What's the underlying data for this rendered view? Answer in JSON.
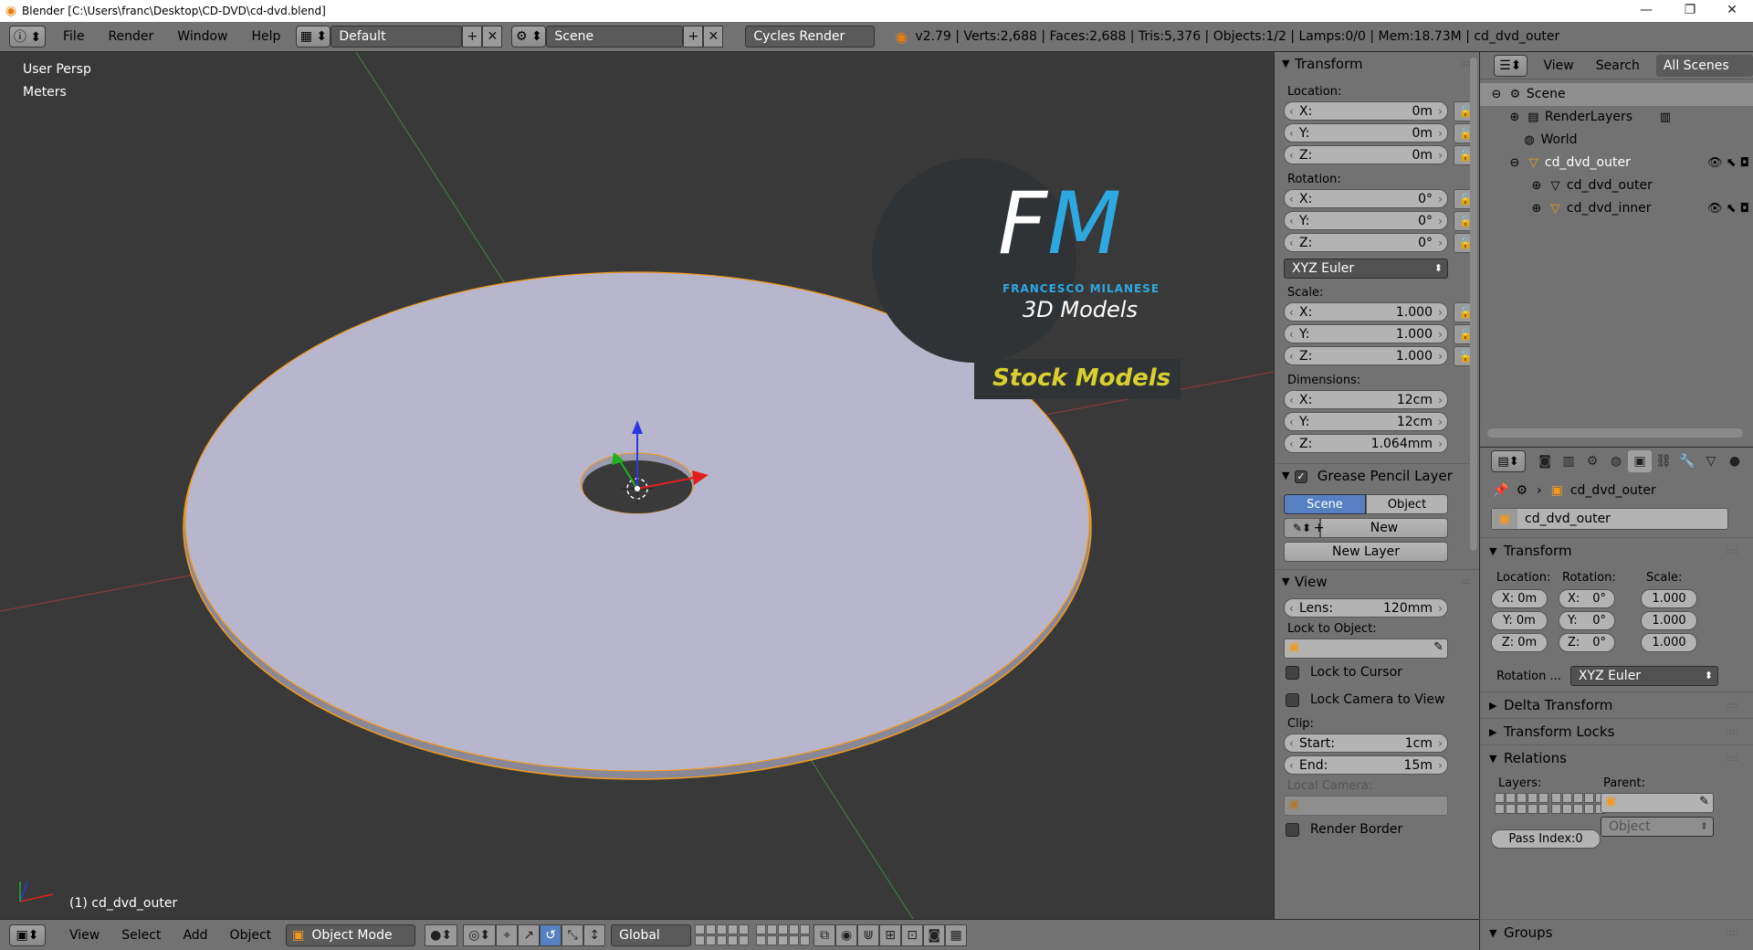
{
  "window": {
    "title": "Blender [C:\\Users\\franc\\Desktop\\CD-DVD\\cd-dvd.blend]",
    "minimize": "—",
    "maximize": "❐",
    "close": "✕"
  },
  "info_header": {
    "menus": [
      "File",
      "Render",
      "Window",
      "Help"
    ],
    "screen_layout": "Default",
    "scene": "Scene",
    "render_engine": "Cycles Render",
    "stats": "v2.79 | Verts:2,688 | Faces:2,688 | Tris:5,376 | Objects:1/2 | Lamps:0/0 | Mem:18.73M | cd_dvd_outer"
  },
  "viewport": {
    "view_name": "User Persp",
    "units": "Meters",
    "active_object": "(1) cd_dvd_outer",
    "watermark": {
      "initials": "FM",
      "name": "FRANCESCO MILANESE",
      "tagline": "3D Models",
      "banner": "Stock Models"
    }
  },
  "npanel": {
    "transform": {
      "title": "Transform",
      "location_label": "Location:",
      "location": [
        {
          "axis": "X:",
          "value": "0m"
        },
        {
          "axis": "Y:",
          "value": "0m"
        },
        {
          "axis": "Z:",
          "value": "0m"
        }
      ],
      "rotation_label": "Rotation:",
      "rotation": [
        {
          "axis": "X:",
          "value": "0°"
        },
        {
          "axis": "Y:",
          "value": "0°"
        },
        {
          "axis": "Z:",
          "value": "0°"
        }
      ],
      "rotation_mode": "XYZ Euler",
      "scale_label": "Scale:",
      "scale": [
        {
          "axis": "X:",
          "value": "1.000"
        },
        {
          "axis": "Y:",
          "value": "1.000"
        },
        {
          "axis": "Z:",
          "value": "1.000"
        }
      ],
      "dimensions_label": "Dimensions:",
      "dimensions": [
        {
          "axis": "X:",
          "value": "12cm"
        },
        {
          "axis": "Y:",
          "value": "12cm"
        },
        {
          "axis": "Z:",
          "value": "1.064mm"
        }
      ]
    },
    "grease_pencil": {
      "title": "Grease Pencil Layer",
      "tab_scene": "Scene",
      "tab_object": "Object",
      "new_label": "New",
      "new_layer_label": "New Layer"
    },
    "view": {
      "title": "View",
      "lens_label": "Lens:",
      "lens_value": "120mm",
      "lock_to_object_label": "Lock to Object:",
      "lock_to_cursor": "Lock to Cursor",
      "lock_camera": "Lock Camera to View",
      "clip_label": "Clip:",
      "clip_start_label": "Start:",
      "clip_start": "1cm",
      "clip_end_label": "End:",
      "clip_end": "15m",
      "local_camera_label": "Local Camera:",
      "render_border": "Render Border"
    }
  },
  "outliner": {
    "header": {
      "view": "View",
      "search": "Search",
      "filter": "All Scenes"
    },
    "items": [
      {
        "label": "Scene"
      },
      {
        "label": "RenderLayers"
      },
      {
        "label": "World"
      },
      {
        "label": "cd_dvd_outer"
      },
      {
        "label": "cd_dvd_outer"
      },
      {
        "label": "cd_dvd_inner"
      }
    ]
  },
  "properties": {
    "breadcrumb_object": "cd_dvd_outer",
    "object_name": "cd_dvd_outer",
    "transform": {
      "title": "Transform",
      "location_label": "Location:",
      "rotation_label": "Rotation:",
      "scale_label": "Scale:",
      "location": [
        "X: 0m",
        "Y: 0m",
        "Z: 0m"
      ],
      "rotation": [
        {
          "axis": "X:",
          "value": "0°"
        },
        {
          "axis": "Y:",
          "value": "0°"
        },
        {
          "axis": "Z:",
          "value": "0°"
        }
      ],
      "scale": [
        "1.000",
        "1.000",
        "1.000"
      ],
      "rotation_mode_label": "Rotation ...",
      "rotation_mode": "XYZ Euler"
    },
    "delta_transform": "Delta Transform",
    "transform_locks": "Transform Locks",
    "relations": {
      "title": "Relations",
      "layers_label": "Layers:",
      "parent_label": "Parent:",
      "parent_type": "Object",
      "pass_index": "Pass Index:0"
    },
    "groups": "Groups"
  },
  "bottom_header": {
    "menus": [
      "View",
      "Select",
      "Add",
      "Object"
    ],
    "mode": "Object Mode",
    "orientation": "Global"
  },
  "colors": {
    "panel_bg": "#727272",
    "viewport_bg": "#393939",
    "disc_face": "#b8b6cc",
    "selection_outline": "#f29a1c",
    "watermark_blue": "#2ea8e0",
    "banner_yellow": "#d9d030"
  }
}
